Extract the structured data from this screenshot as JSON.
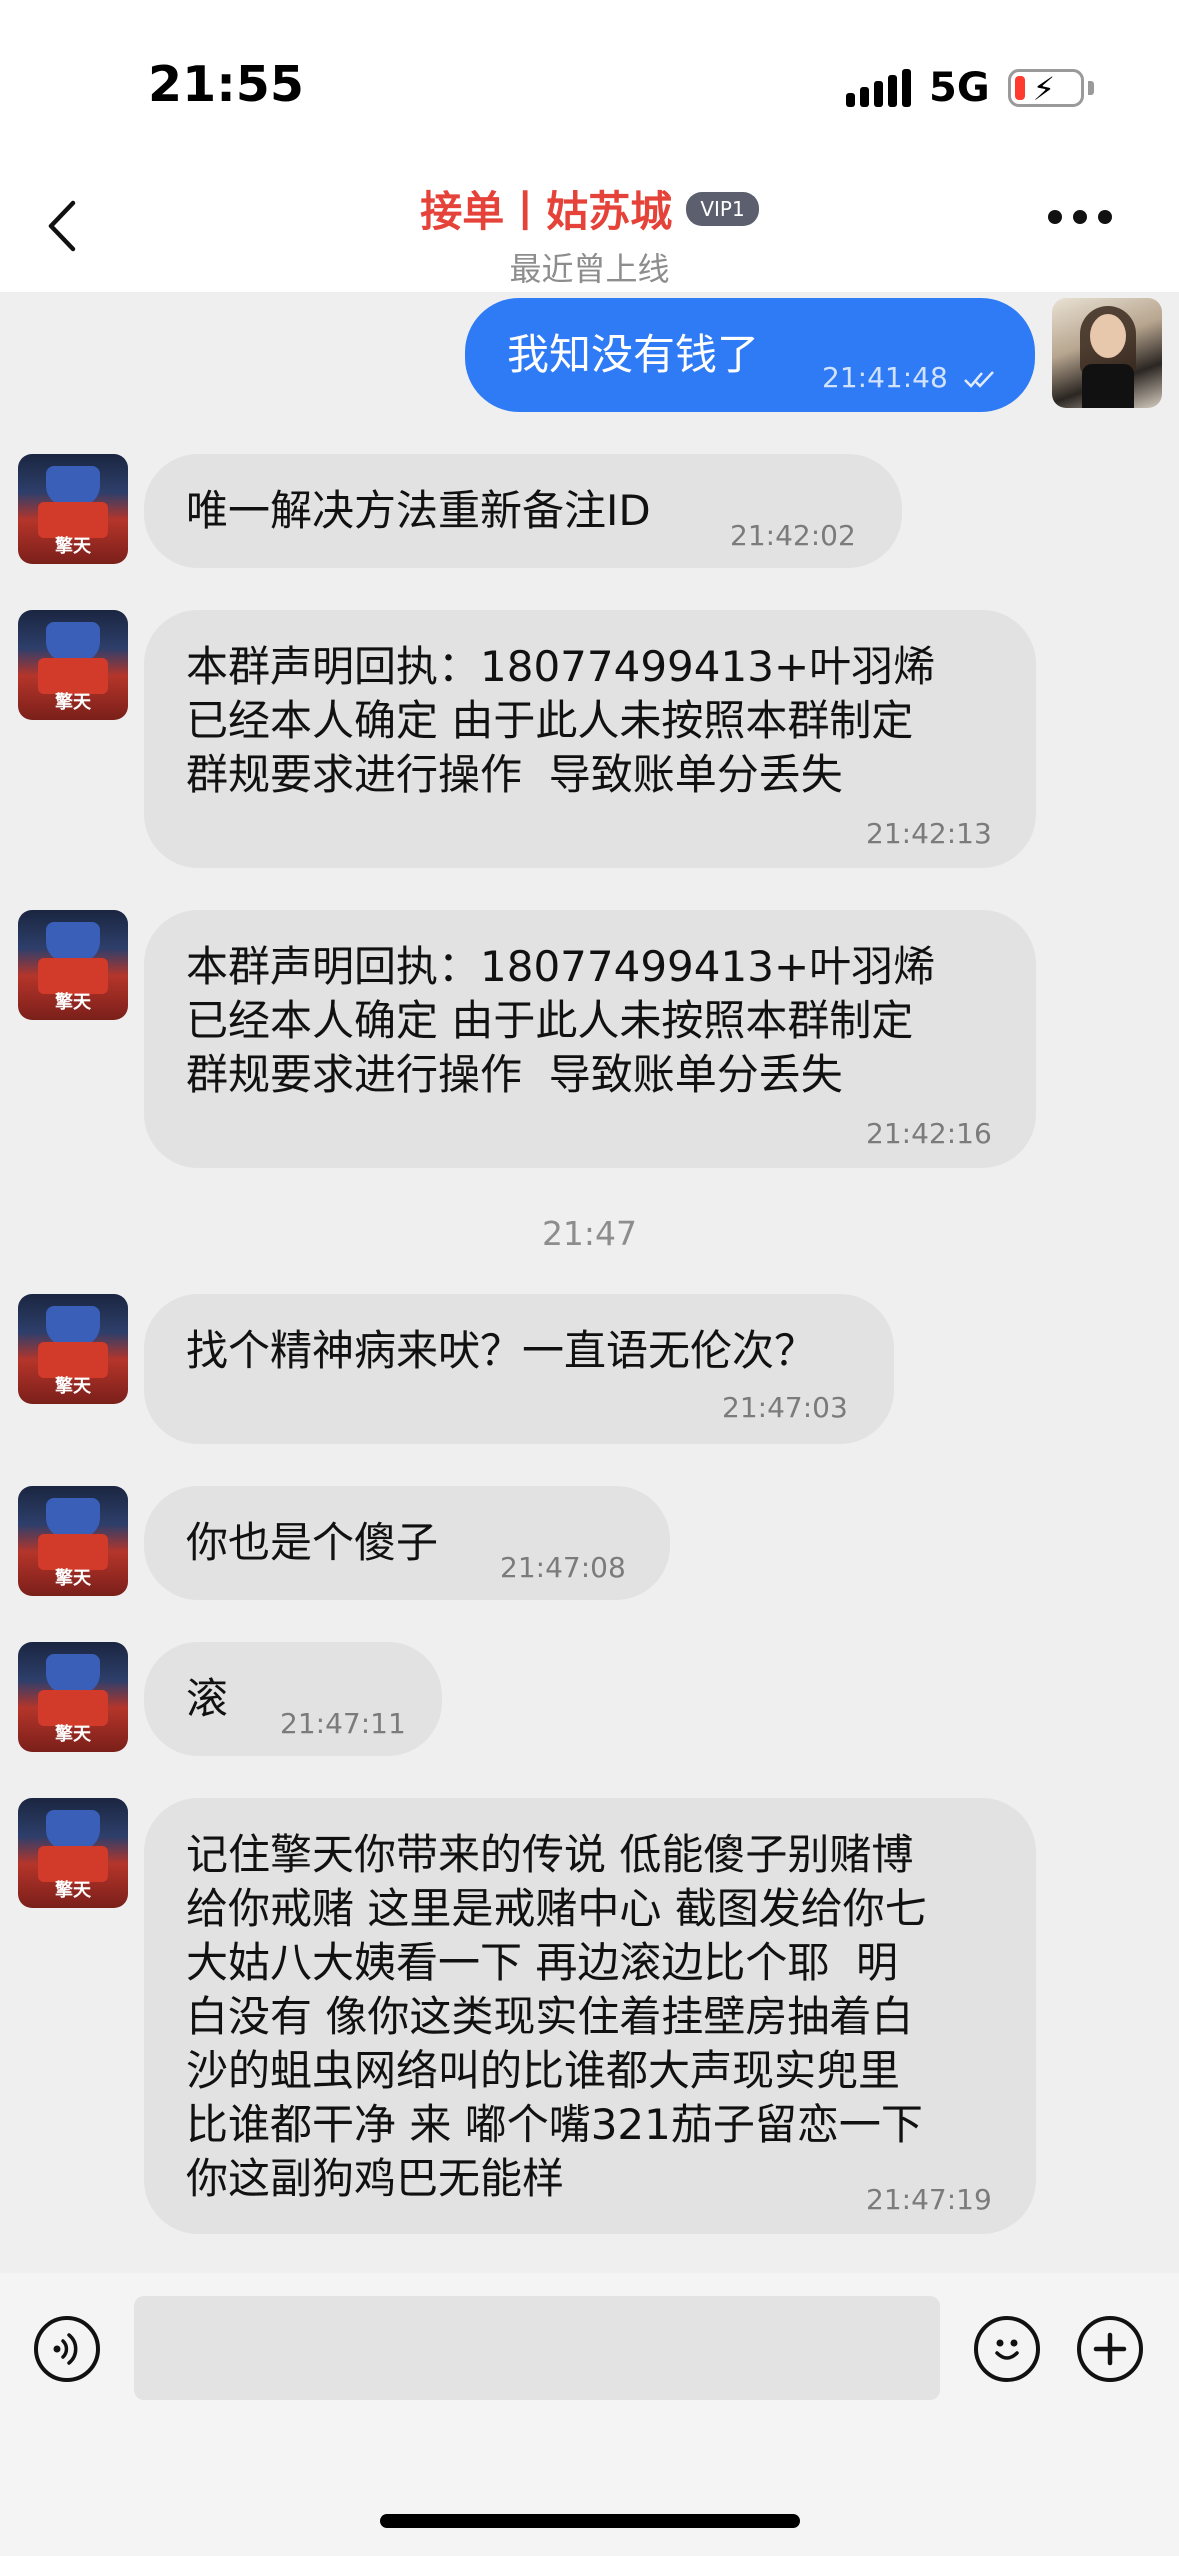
{
  "status_bar": {
    "time": "21:55",
    "network": "5G",
    "battery_level": 0.15
  },
  "header": {
    "back_icon": "chevron-left-icon",
    "title": "接单丨姑苏城",
    "badge": "VIP1",
    "subtitle": "最近曾上线",
    "more_icon": "more-horizontal-icon"
  },
  "colors": {
    "title": "#e5433a",
    "outgoing_bubble": "#2f7bf6",
    "incoming_bubble": "#e2e2e2"
  },
  "messages": [
    {
      "direction": "outgoing",
      "text": "我知没有钱了",
      "time": "21:41:48",
      "read_icon": "double-check-icon"
    },
    {
      "direction": "incoming",
      "text": "唯一解决方法重新备注ID",
      "time": "21:42:02"
    },
    {
      "direction": "incoming",
      "text": "本群声明回执：18077499413+叶羽烯\n已经本人确定 由于此人未按照本群制定\n群规要求进行操作  导致账单分丢失",
      "time": "21:42:13"
    },
    {
      "direction": "incoming",
      "text": "本群声明回执：18077499413+叶羽烯\n已经本人确定 由于此人未按照本群制定\n群规要求进行操作  导致账单分丢失",
      "time": "21:42:16"
    },
    {
      "direction": "incoming",
      "text": "找个精神病来吠？一直语无伦次？",
      "time": "21:47:03"
    },
    {
      "direction": "incoming",
      "text": "你也是个傻子",
      "time": "21:47:08"
    },
    {
      "direction": "incoming",
      "text": "滚",
      "time": "21:47:11"
    },
    {
      "direction": "incoming",
      "text": "记住擎天你带来的传说 低能傻子别赌博\n给你戒赌 这里是戒赌中心 截图发给你七\n大姑八大姨看一下 再边滚边比个耶  明\n白没有 像你这类现实住着挂壁房抽着白\n沙的蛆虫网络叫的比谁都大声现实兜里\n比谁都干净 来 嘟个嘴321茄子留恋一下\n你这副狗鸡巴无能样",
      "time": "21:47:19"
    }
  ],
  "separator_time": "21:47",
  "input_bar": {
    "voice_icon": "voice-icon",
    "placeholder": "",
    "emoji_icon": "emoji-icon",
    "plus_icon": "plus-icon"
  }
}
